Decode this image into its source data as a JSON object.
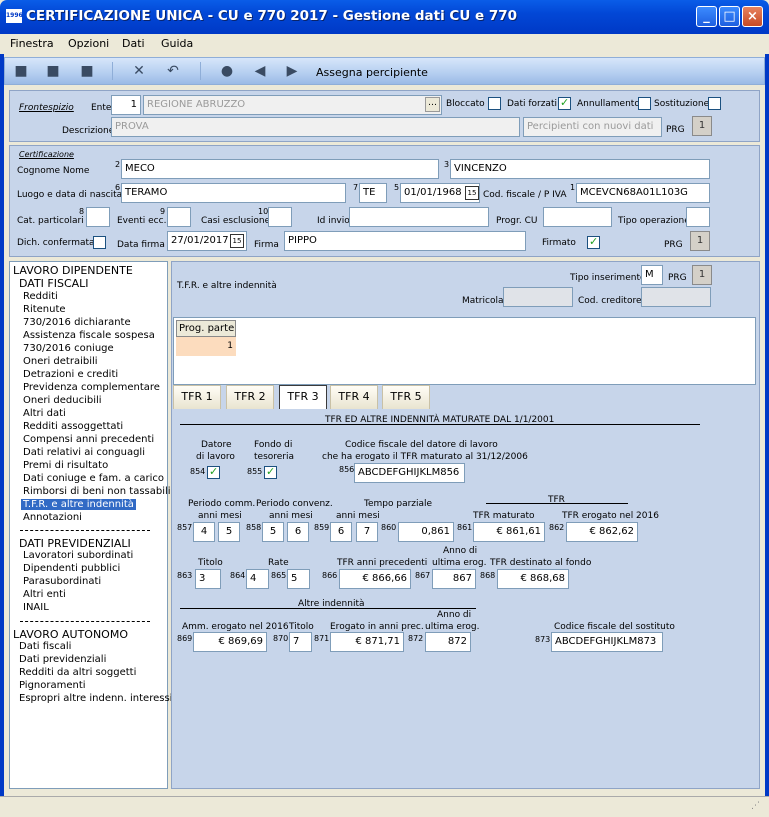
{
  "window": {
    "title": "CERTIFICAZIONE UNICA - CU e 770 2017 - Gestione dati CU e 770",
    "app_icon_text": "1996"
  },
  "menu": [
    "Finestra",
    "Opzioni",
    "Dati",
    "Guida"
  ],
  "toolbar": {
    "assign_label": "Assegna percipiente",
    "icons": [
      "new-icon",
      "copy-icon",
      "save-icon",
      "delete-icon",
      "undo-icon",
      "search-icon",
      "prev-icon",
      "next-icon"
    ]
  },
  "frontespizio": {
    "section_label": "Frontespizio",
    "ente_label": "Ente",
    "ente_num": "1",
    "ente_name": "REGIONE ABRUZZO",
    "bloccato_label": "Bloccato",
    "dati_forzati_label": "Dati forzati",
    "annullamento_label": "Annullamento",
    "sostituzione_label": "Sostituzione",
    "descrizione_label": "Descrizione",
    "descrizione_value": "PROVA",
    "percipienti_placeholder": "Percipienti con nuovi dati",
    "prg_label": "PRG",
    "prg_value": "1"
  },
  "certificazione": {
    "section_label": "Certificazione",
    "cognome_label": "Cognome Nome",
    "cognome": "MECO",
    "nome": "VINCENZO",
    "luogo_label": "Luogo e data di nascita",
    "luogo": "TERAMO",
    "provincia": "TE",
    "data_nascita": "01/01/1968",
    "cf_label": "Cod. fiscale / P IVA",
    "cf": "MCEVCN68A01L103G",
    "cat_label": "Cat. particolari",
    "eventi_label": "Eventi ecc.",
    "casi_label": "Casi esclusione",
    "idinvio_label": "Id invio",
    "progcu_label": "Progr. CU",
    "tipo_op_label": "Tipo operazione",
    "dich_label": "Dich. confermata",
    "data_firma_label": "Data firma",
    "data_firma": "27/01/2017",
    "firma_label": "Firma",
    "firma": "PIPPO",
    "firmato_label": "Firmato",
    "prg_label": "PRG",
    "prg_value": "1",
    "sup": {
      "s2": "2",
      "s3": "3",
      "s6": "6",
      "s7": "7",
      "s5": "5",
      "s1": "1",
      "s8": "8",
      "s9": "9",
      "s10": "10"
    }
  },
  "nav": {
    "lavoro_dipendente": "LAVORO DIPENDENTE",
    "dati_fiscali": "DATI FISCALI",
    "fiscali_items": [
      "Redditi",
      "Ritenute",
      "730/2016 dichiarante",
      "Assistenza fiscale sospesa",
      "730/2016 coniuge",
      "Oneri detraibili",
      "Detrazioni e crediti",
      "Previdenza complementare",
      "Oneri deducibili",
      "Altri dati",
      "Redditi assoggettati",
      "Compensi anni precedenti",
      "Dati relativi ai conguagli",
      "Premi di risultato",
      "Dati coniuge e fam. a carico",
      "Rimborsi di beni non tassabili",
      "T.F.R. e altre indennità",
      "Annotazioni"
    ],
    "dati_previdenziali": "DATI PREVIDENZIALI",
    "prev_items": [
      "Lavoratori subordinati",
      "Dipendenti pubblici",
      "Parasubordinati",
      "Altri enti",
      "INAIL"
    ],
    "lavoro_autonomo": "LAVORO AUTONOMO",
    "auto_items": [
      "Dati fiscali",
      "Dati previdenziali",
      "Redditi da altri soggetti",
      "Pignoramenti",
      "Espropri altre indenn. interessi"
    ]
  },
  "main": {
    "header_label": "T.F.R. e altre indennità",
    "tipo_ins_label": "Tipo inserimento",
    "tipo_ins_value": "M",
    "prg_label": "PRG",
    "prg_value": "1",
    "matricola_label": "Matricola",
    "cod_creditore_label": "Cod. creditore",
    "prog_parte_label": "Prog. parte",
    "prog_parte_value": "1",
    "tabs": [
      "TFR 1",
      "TFR 2",
      "TFR 3",
      "TFR 4",
      "TFR 5"
    ],
    "section_title": "TFR ED ALTRE INDENNITÀ MATURATE DAL 1/1/2001",
    "datore_label_1": "Datore",
    "datore_label_2": "di lavoro",
    "fondo_label_1": "Fondo di",
    "fondo_label_2": "tesoreria",
    "cf_datore_label_1": "Codice fiscale del datore di lavoro",
    "cf_datore_label_2": "che ha erogato il TFR maturato al 31/12/2006",
    "cf_datore": "ABCDEFGHIJKLM856",
    "periodo_comm_label": "Periodo comm.",
    "periodo_conv_label": "Periodo convenz.",
    "tempo_parziale_label": "Tempo parziale",
    "anni_mesi_label": "anni mesi",
    "tfr_label": "TFR",
    "tfr_maturato_label": "TFR maturato",
    "tfr_erogato_label": "TFR erogato nel 2016",
    "titolo_label": "Titolo",
    "rate_label": "Rate",
    "tfr_prec_label": "TFR anni precedenti",
    "anno_ult_label_1": "Anno di",
    "anno_ult_label_2": "ultima erog.",
    "tfr_fondo_label": "TFR destinato al fondo",
    "altre_label": "Altre indennità",
    "amm_label": "Amm. erogato nel 2016",
    "titolo2_label": "Titolo",
    "erogato_prec_label": "Erogato in anni prec.",
    "anno2_label_1": "Anno di",
    "anno2_label_2": "ultima erog.",
    "cf_sost_label": "Codice fiscale del sostituto",
    "fields": {
      "f854": "854",
      "f855": "855",
      "f856": "856",
      "f857": "857",
      "f858": "858",
      "f859": "859",
      "f860": "860",
      "f861": "861",
      "f862": "862",
      "f863": "863",
      "f864": "864",
      "f865": "865",
      "f866": "866",
      "f867": "867",
      "f868": "868",
      "f869": "869",
      "f870": "870",
      "f871": "871",
      "f872": "872",
      "f873": "873"
    },
    "values": {
      "comm_anni": "4",
      "comm_mesi": "5",
      "conv_anni": "5",
      "conv_mesi": "6",
      "tp_anni": "6",
      "tp_mesi": "7",
      "tp_pct": "0,861",
      "tfr_maturato": "€ 861,61",
      "tfr_erogato": "€ 862,62",
      "titolo": "3",
      "rate_1": "4",
      "rate_2": "5",
      "tfr_prec": "€ 866,66",
      "anno_ult": "867",
      "tfr_fondo": "€ 868,68",
      "amm_erogato": "€ 869,69",
      "titolo2": "7",
      "erogato_prec": "€ 871,71",
      "anno2": "872",
      "cf_sost": "ABCDEFGHIJKLM873"
    }
  }
}
